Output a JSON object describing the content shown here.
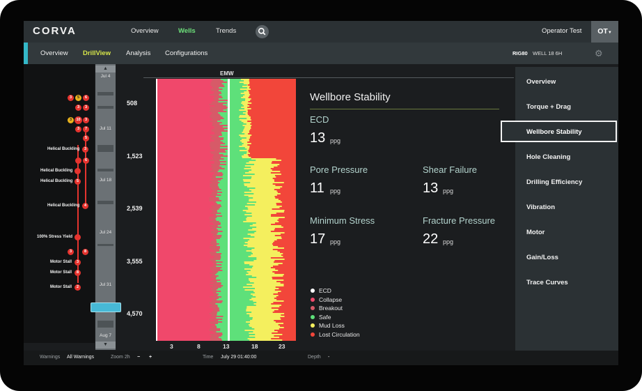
{
  "app": {
    "logo": "CORVA"
  },
  "topnav": {
    "items": [
      "Overview",
      "Wells",
      "Trends"
    ],
    "active": "Wells",
    "user": "Operator Test",
    "initials": "OT"
  },
  "subnav": {
    "items": [
      "Overview",
      "DrillView",
      "Analysis",
      "Configurations"
    ],
    "active": "DrillView",
    "rig": "RIG80",
    "well": "WELL 18 6H"
  },
  "timeline": {
    "dates": [
      "Jul 4",
      "Jul 11",
      "Jul 18",
      "Jul 24",
      "Jul 31",
      "Aug 7"
    ]
  },
  "events": {
    "labels": [
      "Helical Buckling",
      "Helical Buckling",
      "Helical Buckling",
      "Helical Buckling",
      "100% Stress Yield",
      "Motor Stall",
      "Motor Stall",
      "Motor Stall"
    ],
    "badges": [
      "3",
      "5",
      "6",
      "3",
      "3",
      "3",
      "10",
      "3",
      "3",
      "7",
      "5",
      "3",
      "6",
      "5",
      "3",
      "4",
      "8",
      "3",
      "2"
    ]
  },
  "chart": {
    "header": "EMW",
    "depth_labels": [
      "508",
      "1,523",
      "2,539",
      "3,555",
      "4,570"
    ],
    "x_ticks": [
      "3",
      "8",
      "13",
      "18",
      "23"
    ]
  },
  "chart_data": {
    "type": "area",
    "title": "EMW",
    "x_ticks": [
      3,
      8,
      13,
      18,
      23
    ],
    "xlim": [
      0,
      25
    ],
    "y_ticks": [
      508,
      1523,
      2539,
      3555,
      4570
    ],
    "ylim": [
      0,
      5000
    ],
    "y_inverted": true,
    "series": [
      {
        "name": "ECD",
        "color": "#ffffff",
        "values": [
          13,
          13,
          13,
          13,
          13
        ]
      },
      {
        "name": "Collapse",
        "color": "#f0486b"
      },
      {
        "name": "Breakout",
        "color": "#d75a68"
      },
      {
        "name": "Safe",
        "color": "#5ee07a"
      },
      {
        "name": "Mud Loss",
        "color": "#f4ef5e"
      },
      {
        "name": "Lost Circulation",
        "color": "#f2463a"
      }
    ]
  },
  "stability": {
    "title": "Wellbore Stability",
    "unit": "ppg",
    "ecd": {
      "label": "ECD",
      "value": "13"
    },
    "pore_pressure": {
      "label": "Pore Pressure",
      "value": "11"
    },
    "shear_failure": {
      "label": "Shear Failure",
      "value": "13"
    },
    "minimum_stress": {
      "label": "Minimum Stress",
      "value": "17"
    },
    "fracture_pressure": {
      "label": "Fracture Pressure",
      "value": "22"
    }
  },
  "legend": [
    {
      "label": "ECD",
      "color": "#ffffff"
    },
    {
      "label": "Collapse",
      "color": "#f0486b"
    },
    {
      "label": "Breakout",
      "color": "#d75a68"
    },
    {
      "label": "Safe",
      "color": "#5ee07a"
    },
    {
      "label": "Mud Loss",
      "color": "#f4ef5e"
    },
    {
      "label": "Lost Circulation",
      "color": "#f2463a"
    }
  ],
  "right_menu": {
    "items": [
      "Overview",
      "Torque + Drag",
      "Wellbore Stability",
      "Hole Cleaning",
      "Drilling Efficiency",
      "Vibration",
      "Motor",
      "Gain/Loss",
      "Trace Curves"
    ],
    "active": "Wellbore Stability"
  },
  "statusbar": {
    "warnings_label": "Warnings",
    "warnings_value": "All Warnings",
    "zoom_label": "Zoom 2h",
    "zoom_minus": "−",
    "zoom_plus": "+",
    "time_label": "Time",
    "time_value": "July 29 01:40:00",
    "depth_label": "Depth",
    "depth_value": "-"
  },
  "icons": {
    "search": "search-icon",
    "gear": "gear-icon",
    "caret": "caret-down-icon",
    "scroll_up": "arrow-up-icon",
    "scroll_down": "arrow-down-icon"
  }
}
